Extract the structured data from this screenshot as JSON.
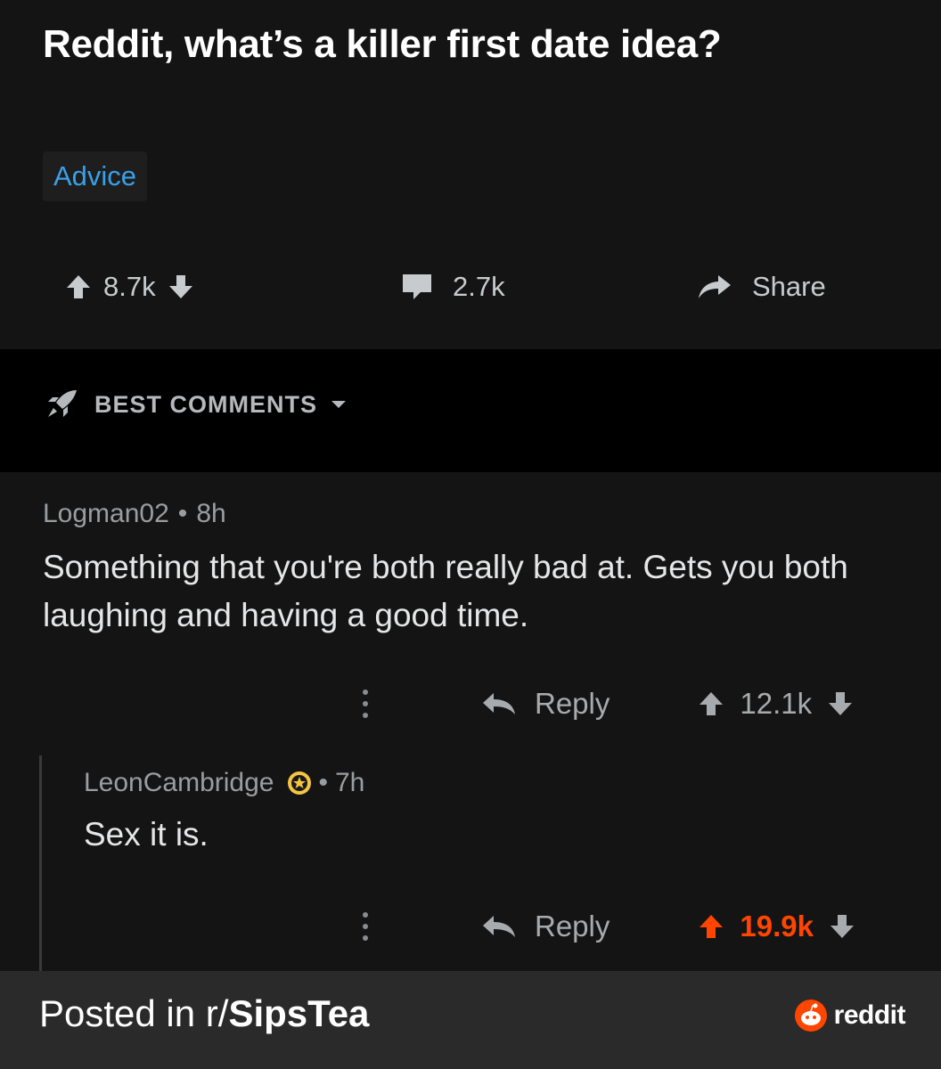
{
  "post": {
    "title": "Reddit, what’s a killer first date idea?",
    "flair": "Advice",
    "votes": "8.7k",
    "comments_count": "2.7k",
    "share_label": "Share"
  },
  "sort": {
    "label": "BEST COMMENTS"
  },
  "comments": [
    {
      "author": "Logman02",
      "separator": "•",
      "age": "8h",
      "body": "Something that you're both really bad at.  Gets you both laughing and having a good time.",
      "reply_label": "Reply",
      "score": "12.1k",
      "upvoted": false
    },
    {
      "author": "LeonCambridge",
      "separator": "•",
      "age": "7h",
      "body": "Sex it is.",
      "reply_label": "Reply",
      "score": "19.9k",
      "upvoted": true
    }
  ],
  "footer": {
    "posted_prefix": "Posted in r/",
    "subreddit": "SipsTea",
    "brand": "reddit"
  },
  "colors": {
    "background": "#000000",
    "panel": "#141414",
    "footer": "#2a2a2a",
    "flair_text": "#3aa0e8",
    "upvote_active": "#ff4500",
    "award": "#f5c542"
  },
  "icons": [
    "upvote-icon",
    "downvote-icon",
    "comment-icon",
    "share-icon",
    "rocket-icon",
    "caret-down-icon",
    "more-icon",
    "reply-icon",
    "award-icon",
    "reddit-logo-icon"
  ]
}
